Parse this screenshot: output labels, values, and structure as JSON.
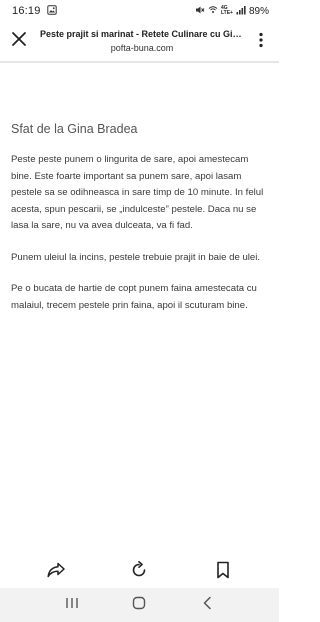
{
  "status_bar": {
    "time": "16:19",
    "network_type_top": "4G",
    "network_type_bottom": "LTE+",
    "battery_percent": "89%"
  },
  "title_bar": {
    "title": "Peste prajit si marinat - Retete Culinare cu Gina...",
    "url": "pofta-buna.com"
  },
  "article": {
    "heading": "Sfat de la Gina Bradea",
    "paragraphs": [
      "Peste peste punem o lingurita de sare, apoi amestecam bine. Este foarte important sa punem sare, apoi lasam pestele sa se odihneasca in sare timp de 10 minute. In felul acesta, spun pescarii, se „indulceste” pestele. Daca nu se lasa la sare, nu va avea dulceata, va fi fad.",
      "Punem uleiul la incins, pestele trebuie prajit in baie de ulei.",
      "Pe o bucata de hartie de copt punem faina amestecata cu malaiul, trecem pestele prin faina, apoi il scuturam bine."
    ]
  },
  "icons": {
    "close": "close-icon",
    "menu": "more-vertical-icon",
    "share": "share-icon",
    "refresh": "refresh-icon",
    "bookmark": "bookmark-icon",
    "recent_apps": "recent-apps-icon",
    "home": "home-icon",
    "back": "back-icon"
  },
  "colors": {
    "accent": "#1a73e8",
    "text": "#3a3a3a",
    "heading": "#555555",
    "nav_background": "#f2f2f2"
  }
}
